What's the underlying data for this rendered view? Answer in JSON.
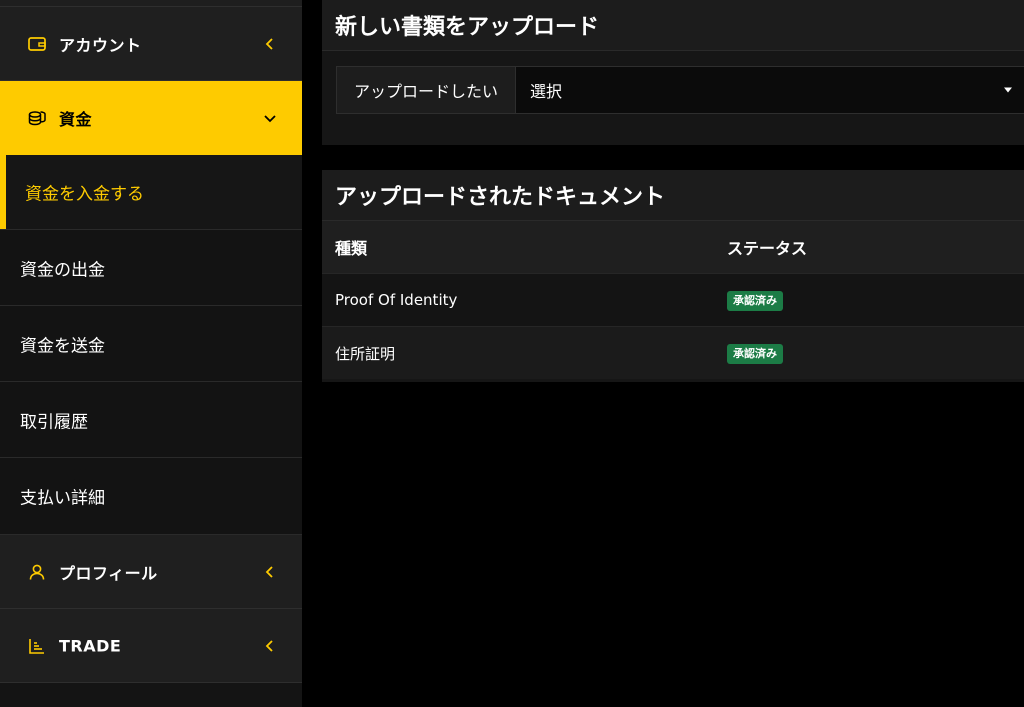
{
  "sidebar": {
    "groups": {
      "account": {
        "label": "アカウント",
        "icon": "wallet-icon"
      },
      "funds": {
        "label": "資金",
        "icon": "coins-icon"
      },
      "profile": {
        "label": "プロフィール",
        "icon": "user-icon"
      },
      "trade": {
        "label": "TRADE",
        "icon": "chart-icon"
      }
    },
    "funds_items": [
      {
        "label": "資金を入金する",
        "current": true
      },
      {
        "label": "資金の出金"
      },
      {
        "label": "資金を送金"
      },
      {
        "label": "取引履歴"
      },
      {
        "label": "支払い詳細"
      }
    ]
  },
  "upload": {
    "title": "新しい書類をアップロード",
    "field_label": "アップロードしたい",
    "select_value": "選択"
  },
  "documents": {
    "title": "アップロードされたドキュメント",
    "columns": {
      "type": "種類",
      "status": "ステータス"
    },
    "rows": [
      {
        "type": "Proof Of Identity",
        "status": "承認済み"
      },
      {
        "type": "住所証明",
        "status": "承認済み"
      }
    ]
  },
  "colors": {
    "accent": "#fecb00",
    "approved": "#1c7c46",
    "sidebar_bg": "#1f1f1f",
    "page_bg": "#000000"
  }
}
